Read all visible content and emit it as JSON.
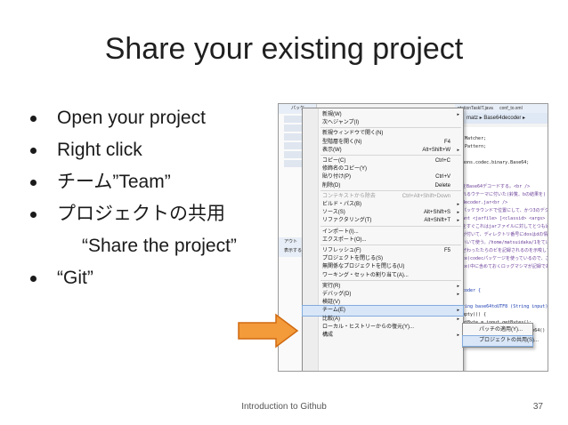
{
  "slide": {
    "title": "Share your existing project",
    "bullets": [
      {
        "text": "Open your project"
      },
      {
        "text": "Right click"
      },
      {
        "text": "チーム”Team”"
      },
      {
        "text": "プロジェクトの共用"
      },
      {
        "text": "“Share the project”",
        "sub": true
      },
      {
        "text": "“Git”"
      }
    ],
    "footer": {
      "text": "Introduction to Github",
      "page": "37"
    }
  },
  "screenshot": {
    "pkg_tree_header": "パッケ",
    "outline_header": "アウト",
    "outline_sub": "表示する",
    "editor_tabs": [
      "ntationTaskIT.java",
      "conf_to.xml"
    ],
    "editor_subtab": "matz ▸ Base64decoder ▸",
    "code_lines": [
      {
        "text": "",
        "cls": ""
      },
      {
        "text": ".Matcher;",
        "cls": ""
      },
      {
        "text": ".Pattern;",
        "cls": ""
      },
      {
        "text": "",
        "cls": ""
      },
      {
        "text": "mons.codec.binary.Base64;",
        "cls": ""
      },
      {
        "text": "",
        "cls": ""
      },
      {
        "text": "",
        "cls": ""
      },
      {
        "text": "をBase64デコードする。<br />",
        "cls": "c-pl"
      },
      {
        "text": "れるウテーマに付いた(鈴覧、bの結果を)",
        "cls": "c-pl"
      },
      {
        "text": "decoder.jar<br />",
        "cls": "c-pl"
      },
      {
        "text": "パッケラウンドで位置にして、かつ3のデクト",
        "cls": "c-pl"
      },
      {
        "text": "ant <jarfile> [<classid> <args>",
        "cls": "c-pl"
      },
      {
        "text": "をすぐこれはjarファイルに対してとつも通り",
        "cls": "c-pl"
      },
      {
        "text": "が付いて、ディレクトリ番号にdosはdの情",
        "cls": "c-pl"
      },
      {
        "text": "ハいて使う。/home/matsuidaka/1をてに置",
        "cls": "c-pl"
      },
      {
        "text": "ぜわったたらのビを記録されるのを示唆して",
        "cls": "c-pl"
      },
      {
        "text": "ce)codecパッケージを使っているので、これを",
        "cls": "c-pl"
      },
      {
        "text": "ce)中に含めておくロッグマシマが記録である",
        "cls": "c-pl"
      },
      {
        "text": "",
        "cls": ""
      },
      {
        "text": "",
        "cls": ""
      },
      {
        "text": "coder {",
        "cls": "c-bl"
      },
      {
        "text": "",
        "cls": ""
      },
      {
        "text": "ring base64toUTF8 (String input)",
        "cls": "c-bl"
      },
      {
        "text": "mpty()) {",
        "cls": ""
      },
      {
        "text": "utByte = input.getBytes();",
        "cls": ""
      },
      {
        "text": "outByte = Base64.decodeBase64()",
        "cls": ""
      }
    ],
    "context_menu": [
      {
        "label": "新規(W)",
        "shortcut": "",
        "submenu": true
      },
      {
        "label": "次へジャンプ(I)",
        "shortcut": "",
        "submenu": false
      },
      {
        "sep": true
      },
      {
        "label": "新規ウィンドウで開く(N)",
        "shortcut": "",
        "submenu": false
      },
      {
        "label": "型階層を開く(N)",
        "shortcut": "F4",
        "submenu": false
      },
      {
        "label": "表示(W)",
        "shortcut": "Alt+Shift+W",
        "submenu": true
      },
      {
        "sep": true
      },
      {
        "label": "コピー(C)",
        "shortcut": "Ctrl+C",
        "submenu": false
      },
      {
        "label": "修飾名のコピー(Y)",
        "shortcut": "",
        "submenu": false
      },
      {
        "label": "貼り付け(P)",
        "shortcut": "Ctrl+V",
        "submenu": false
      },
      {
        "label": "削除(D)",
        "shortcut": "Delete",
        "submenu": false
      },
      {
        "sep": true
      },
      {
        "label": "コンテキストから除去",
        "shortcut": "Ctrl+Alt+Shift+Down",
        "submenu": false,
        "disabled": true
      },
      {
        "label": "ビルド・パス(B)",
        "shortcut": "",
        "submenu": true
      },
      {
        "label": "ソース(S)",
        "shortcut": "Alt+Shift+S",
        "submenu": true
      },
      {
        "label": "リファクタリング(T)",
        "shortcut": "Alt+Shift+T",
        "submenu": true
      },
      {
        "sep": true
      },
      {
        "label": "インポート(I)...",
        "shortcut": "",
        "submenu": false
      },
      {
        "label": "エクスポート(O)...",
        "shortcut": "",
        "submenu": false
      },
      {
        "sep": true
      },
      {
        "label": "リフレッシュ(F)",
        "shortcut": "F5",
        "submenu": false
      },
      {
        "label": "プロジェクトを閉じる(S)",
        "shortcut": "",
        "submenu": false
      },
      {
        "label": "無関係なプロジェクトを閉じる(U)",
        "shortcut": "",
        "submenu": false
      },
      {
        "label": "ワーキング・セットの割り当て(A)...",
        "shortcut": "",
        "submenu": false
      },
      {
        "sep": true
      },
      {
        "label": "実行(R)",
        "shortcut": "",
        "submenu": true
      },
      {
        "label": "デバッグ(D)",
        "shortcut": "",
        "submenu": true
      },
      {
        "label": "検証(V)",
        "shortcut": "",
        "submenu": false
      },
      {
        "label": "チーム(E)",
        "shortcut": "",
        "submenu": true,
        "highlight": true
      },
      {
        "label": "比較(A)",
        "shortcut": "",
        "submenu": true
      },
      {
        "label": "ローカル・ヒストリーからの復元(Y)...",
        "shortcut": "",
        "submenu": false
      },
      {
        "label": "構成",
        "shortcut": "",
        "submenu": true
      }
    ],
    "team_submenu": [
      {
        "label": "パッチの適用(Y)..."
      },
      {
        "label": "プロジェクトの共用(S)...",
        "highlight": true
      }
    ]
  },
  "colors": {
    "arrow_fill": "#f39a3a",
    "arrow_stroke": "#d06a10",
    "highlight": "#d8e6f8"
  }
}
